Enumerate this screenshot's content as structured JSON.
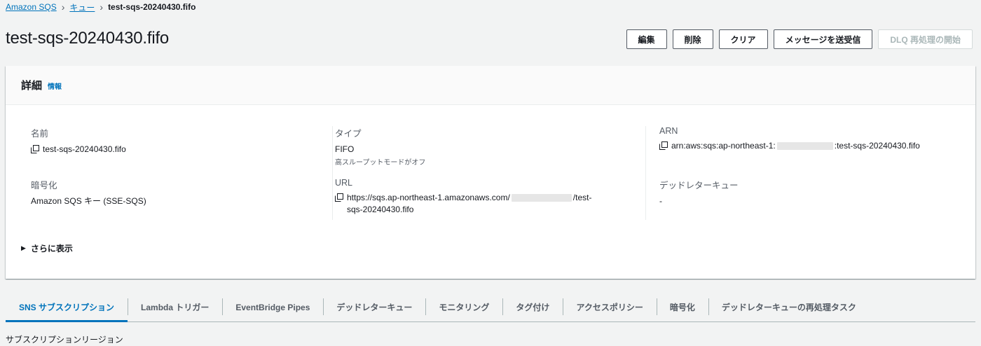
{
  "breadcrumb": {
    "root": "Amazon SQS",
    "queues": "キュー",
    "current": "test-sqs-20240430.fifo"
  },
  "page_title": "test-sqs-20240430.fifo",
  "actions": {
    "edit": "編集",
    "delete": "削除",
    "purge": "クリア",
    "send_receive": "メッセージを送受信",
    "dlq_redrive": "DLQ 再処理の開始"
  },
  "details": {
    "title": "詳細",
    "info": "情報",
    "name_label": "名前",
    "name_value": "test-sqs-20240430.fifo",
    "type_label": "タイプ",
    "type_value": "FIFO",
    "type_sub": "高スループットモードがオフ",
    "arn_label": "ARN",
    "arn_prefix": "arn:aws:sqs:ap-northeast-1:",
    "arn_suffix": ":test-sqs-20240430.fifo",
    "encryption_label": "暗号化",
    "encryption_value": "Amazon SQS キー (SSE-SQS)",
    "url_label": "URL",
    "url_prefix": "https://sqs.ap-northeast-1.amazonaws.com/",
    "url_suffix": "/test-",
    "url_line2": "sqs-20240430.fifo",
    "dlq_label": "デッドレターキュー",
    "dlq_value": "-",
    "show_more": "さらに表示"
  },
  "tabs": [
    {
      "label": "SNS サブスクリプション",
      "active": true
    },
    {
      "label": "Lambda トリガー",
      "active": false
    },
    {
      "label": "EventBridge Pipes",
      "active": false
    },
    {
      "label": "デッドレターキュー",
      "active": false
    },
    {
      "label": "モニタリング",
      "active": false
    },
    {
      "label": "タグ付け",
      "active": false
    },
    {
      "label": "アクセスポリシー",
      "active": false
    },
    {
      "label": "暗号化",
      "active": false
    },
    {
      "label": "デッドレターキューの再処理タスク",
      "active": false
    }
  ],
  "subregion_label": "サブスクリプションリージョン",
  "colors": {
    "link": "#0073bb",
    "text": "#16191f",
    "muted": "#545b64",
    "background": "#f2f3f3"
  },
  "icons": {
    "copy": "copy-icon",
    "expand": "caret-right-icon",
    "separator": "chevron-right-icon"
  }
}
